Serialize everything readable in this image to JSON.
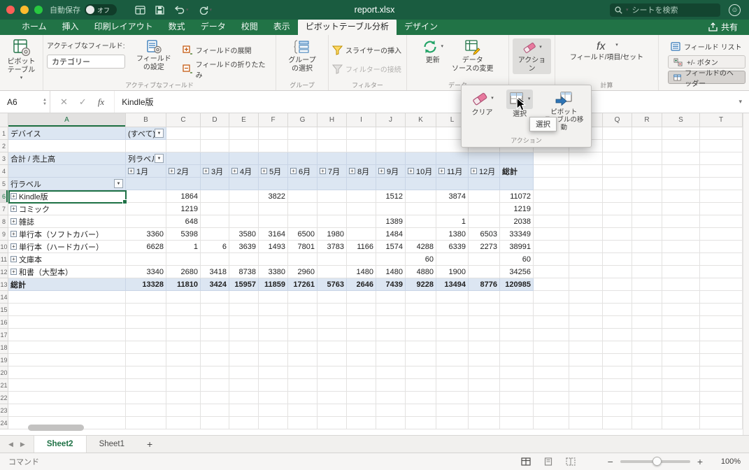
{
  "colors": {
    "accent": "#217346",
    "titlebar": "#1a5c40",
    "pivot_header_fill": "#dce6f2",
    "selection": "#1e7145"
  },
  "titlebar": {
    "autosave_label": "自動保存",
    "autosave_state": "オフ",
    "title": "report.xlsx",
    "search_placeholder": "シートを検索"
  },
  "tabs": [
    {
      "label": "ホーム"
    },
    {
      "label": "挿入"
    },
    {
      "label": "印刷レイアウト"
    },
    {
      "label": "数式"
    },
    {
      "label": "データ"
    },
    {
      "label": "校閲"
    },
    {
      "label": "表示"
    },
    {
      "label": "ピボットテーブル分析"
    },
    {
      "label": "デザイン"
    }
  ],
  "share_label": "共有",
  "ribbon": {
    "pivot_table": "ピボット\nテーブル",
    "active_field_label": "アクティブなフィールド:",
    "active_field_value": "カテゴリー",
    "field_settings": "フィールド\nの設定",
    "expand_field": "フィールドの展開",
    "collapse_field": "フィールドの折りたたみ",
    "group_active_field": "アクティブなフィールド",
    "group_selection_label": "グループ\nの選択",
    "group_group": "グループ",
    "insert_slicer": "スライサーの挿入",
    "filter_connections": "フィルターの接続",
    "group_filter": "フィルター",
    "refresh": "更新",
    "change_data_source": "データ\nソースの変更",
    "group_data": "データ",
    "actions": "アクション",
    "fields_items_sets": "フィールド/項目/セット",
    "group_calc": "計算",
    "field_list": "フィールド リスト",
    "plus_minus_button": "+/- ボタン",
    "field_headers": "フィールドのヘッダー"
  },
  "actions_menu": {
    "clear": "クリア",
    "select": "選択",
    "move_pivot": "ピボット\nテーブルの移動",
    "group_label": "アクション",
    "tooltip": "選択"
  },
  "formula_bar": {
    "name_box": "A6",
    "value": "Kindle版"
  },
  "grid": {
    "columns": [
      "A",
      "B",
      "C",
      "D",
      "E",
      "F",
      "G",
      "H",
      "I",
      "J",
      "K",
      "L",
      "M",
      "N",
      "O",
      "P",
      "Q",
      "R",
      "S",
      "T"
    ],
    "row_count": 24
  },
  "pivot": {
    "device_label": "デバイス",
    "device_value": "(すべて)",
    "sum_label": "合計 / 売上高",
    "col_labels": "列ラベル",
    "row_labels": "行ラベル",
    "months": [
      "1月",
      "2月",
      "3月",
      "4月",
      "5月",
      "6月",
      "7月",
      "8月",
      "9月",
      "10月",
      "11月",
      "12月"
    ],
    "total_label": "総計",
    "rows": [
      {
        "label": "Kindle版",
        "values": [
          "",
          "1864",
          "",
          "",
          "3822",
          "",
          "",
          "",
          "1512",
          "",
          "3874",
          "",
          "11072"
        ]
      },
      {
        "label": "コミック",
        "values": [
          "",
          "1219",
          "",
          "",
          "",
          "",
          "",
          "",
          "",
          "",
          "",
          "",
          "1219"
        ]
      },
      {
        "label": "雑誌",
        "values": [
          "",
          "648",
          "",
          "",
          "",
          "",
          "",
          "",
          "1389",
          "",
          "1",
          "",
          "2038"
        ]
      },
      {
        "label": "単行本（ソフトカバー）",
        "values": [
          "3360",
          "5398",
          "",
          "3580",
          "3164",
          "6500",
          "1980",
          "",
          "1484",
          "",
          "1380",
          "6503",
          "33349"
        ]
      },
      {
        "label": "単行本（ハードカバー）",
        "values": [
          "6628",
          "1",
          "6",
          "3639",
          "1493",
          "7801",
          "3783",
          "1166",
          "1574",
          "4288",
          "6339",
          "2273",
          "38991"
        ]
      },
      {
        "label": "文庫本",
        "values": [
          "",
          "",
          "",
          "",
          "",
          "",
          "",
          "",
          "",
          "60",
          "",
          "",
          "60"
        ]
      },
      {
        "label": "和書（大型本）",
        "values": [
          "3340",
          "2680",
          "3418",
          "8738",
          "3380",
          "2960",
          "",
          "1480",
          "1480",
          "4880",
          "1900",
          "",
          "34256"
        ]
      }
    ],
    "grand_total_label": "総計",
    "grand_total": [
      "13328",
      "11810",
      "3424",
      "15957",
      "11859",
      "17261",
      "5763",
      "2646",
      "7439",
      "9228",
      "13494",
      "8776",
      "120985"
    ]
  },
  "sheet_tabs": {
    "tabs": [
      "Sheet2",
      "Sheet1"
    ]
  },
  "status_bar": {
    "left": "コマンド",
    "zoom": "100%"
  }
}
